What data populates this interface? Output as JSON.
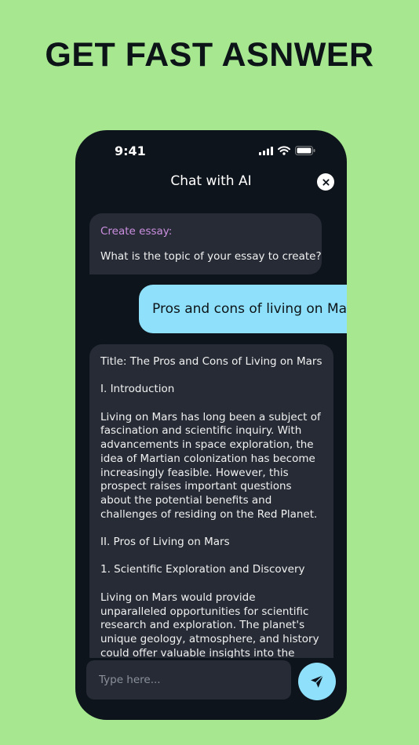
{
  "headline": "GET FAST ASNWER",
  "status_bar": {
    "time": "9:41",
    "icons": [
      "cellular-signal-icon",
      "wifi-icon",
      "battery-icon"
    ]
  },
  "chat": {
    "title": "Chat with AI",
    "close_icon": "close-icon"
  },
  "messages": {
    "ai_prompt": {
      "label": "Create essay:",
      "question": "What is the topic of your essay to create?"
    },
    "user_reply": "Pros and cons of living on Mars",
    "essay": {
      "paragraphs": [
        "Title: The Pros and Cons of Living on Mars",
        "I. Introduction",
        "Living on Mars has long been a subject of fascination and scientific inquiry. With advancements in space exploration, the idea of Martian colonization has become increasingly feasible. However, this prospect raises important questions about the potential benefits and challenges of residing on the Red Planet.",
        "II. Pros of Living on Mars",
        "1. Scientific Exploration and Discovery",
        "Living on Mars would provide unparalleled opportunities for scientific research and exploration. The planet's unique geology, atmosphere, and history could offer valuable insights into the origins of our"
      ]
    }
  },
  "composer": {
    "placeholder": "Type here...",
    "send_icon": "send-icon"
  },
  "colors": {
    "background": "#a6e790",
    "phone": "#0e141b",
    "bubble": "#262b35",
    "accent": "#8fe0fb",
    "label": "#cc8fe0"
  }
}
